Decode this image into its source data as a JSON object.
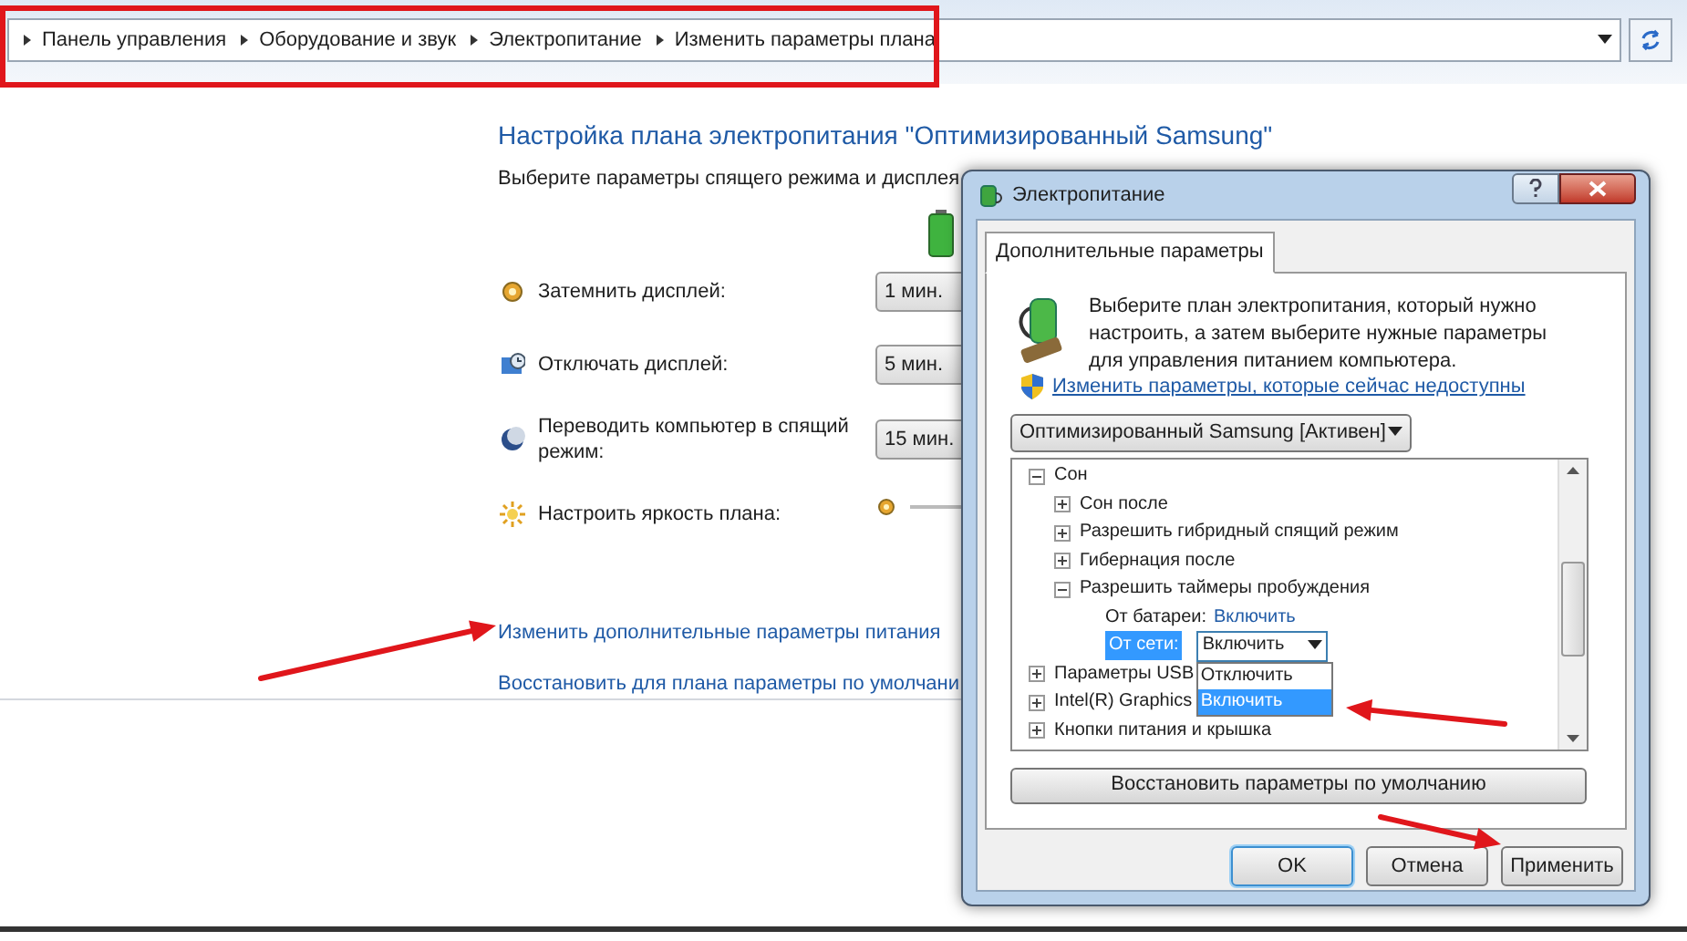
{
  "address_bar": {
    "breadcrumbs": [
      "Панель управления",
      "Оборудование и звук",
      "Электропитание",
      "Изменить параметры плана"
    ]
  },
  "page": {
    "title": "Настройка плана электропитания \"Оптимизированный Samsung\"",
    "subtitle": "Выберите параметры спящего режима и дисплея",
    "settings": [
      {
        "kind": "dropdown",
        "label": "Затемнить дисплей:",
        "value": "1 мин."
      },
      {
        "kind": "dropdown",
        "label": "Отключать дисплей:",
        "value": "5 мин."
      },
      {
        "kind": "dropdown",
        "label": "Переводить компьютер в спящий режим:",
        "value": "15 мин."
      },
      {
        "kind": "slider",
        "label": "Настроить яркость плана:"
      }
    ],
    "links": [
      "Изменить дополнительные параметры питания",
      "Восстановить для плана параметры по умолчани"
    ]
  },
  "dialog": {
    "title": "Электропитание",
    "tabs": [
      {
        "label": "Дополнительные параметры",
        "selected": true
      }
    ],
    "description": "Выберите план электропитания, который нужно настроить, а затем выберите нужные параметры для управления питанием компьютера.",
    "admin_link": "Изменить параметры, которые сейчас недоступны",
    "plan": "Оптимизированный Samsung [Активен]",
    "tree": [
      {
        "kind": "group",
        "label": "Сон",
        "expanded": true,
        "children": [
          {
            "kind": "group",
            "label": "Сон после",
            "expanded": false
          },
          {
            "kind": "group",
            "label": "Разрешить гибридный спящий режим",
            "expanded": false
          },
          {
            "kind": "group",
            "label": "Гибернация после",
            "expanded": false
          },
          {
            "kind": "group",
            "label": "Разрешить таймеры пробуждения",
            "expanded": true,
            "children": [
              {
                "kind": "value",
                "label": "От батареи:",
                "value": "Включить"
              },
              {
                "kind": "select",
                "label": "От сети:",
                "value": "Включить",
                "selected": true,
                "options": [
                  {
                    "label": "Отключить",
                    "selected": false
                  },
                  {
                    "label": "Включить",
                    "selected": true
                  }
                ]
              }
            ]
          }
        ]
      },
      {
        "kind": "group",
        "label": "Параметры USB",
        "expanded": false
      },
      {
        "kind": "group",
        "label": "Intel(R) Graphics",
        "expanded": false
      },
      {
        "kind": "group",
        "label": "Кнопки питания и крышка",
        "expanded": false
      }
    ],
    "restore_button": "Восстановить параметры по умолчанию",
    "buttons": [
      "OK",
      "Отмена",
      "Применить"
    ]
  }
}
